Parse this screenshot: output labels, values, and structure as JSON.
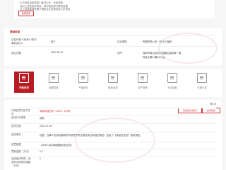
{
  "notice": {
    "line1": "·  以下信息由相关部门依法公示，仅供参考",
    "line2": "·  如对上述信息有异议，请与相关部门联系处理",
    "line3": "·  以上信息数据来源于国家企业信用信息公示系统",
    "button": "查看更多"
  },
  "basic": {
    "title": "基础信息",
    "row1": {
      "k1": "法定代表人/负责人/执行事务合伙人",
      "v1": "张三",
      "k2": "企业类型",
      "v2": "有限责任公司（自然人独资）"
    },
    "row2": {
      "k1": "成立日期",
      "v1": "2020-08-01",
      "k2": "住所",
      "v2": "深圳市南山区科技园南区高新南一道",
      "v2b": "科技大厦12楼1201室"
    }
  },
  "tabs": [
    {
      "label": "行政处罚",
      "active": true
    },
    {
      "label": "经营异常",
      "active": false
    },
    {
      "label": "严重违法",
      "active": false
    },
    {
      "label": "股权出质",
      "active": false
    },
    {
      "label": "动产抵押",
      "active": false
    },
    {
      "label": "司法协助",
      "active": false
    },
    {
      "label": "欠税公告",
      "active": false
    }
  ],
  "detail": {
    "page": "第1页",
    "rows": [
      {
        "key": "行政处罚决定书文号",
        "value": "深南市监罚字〔2021〕113号",
        "red": true
      },
      {
        "key": "违法行为类型",
        "value": "其他",
        "red": false
      },
      {
        "key": "处罚日期",
        "value": "2021-07-26",
        "red": false
      },
      {
        "key": "违法事实",
        "value": "经查，当事人在其经营场所内销售不符合食品安全标准的食品，违反了《食品安全法》相关规定。",
        "red": false
      },
      {
        "key": "处罚依据",
        "value": "《中华人民共和国食品安全法》",
        "red": false
      },
      {
        "key": "罚款金额（万元）",
        "value": "0.2",
        "red": false
      },
      {
        "key": "没收违法所得、没收非法财物的金额（万元）",
        "value": "0",
        "red": false
      }
    ],
    "badge1": "行政处罚决定书",
    "badge2": "信用修复"
  }
}
